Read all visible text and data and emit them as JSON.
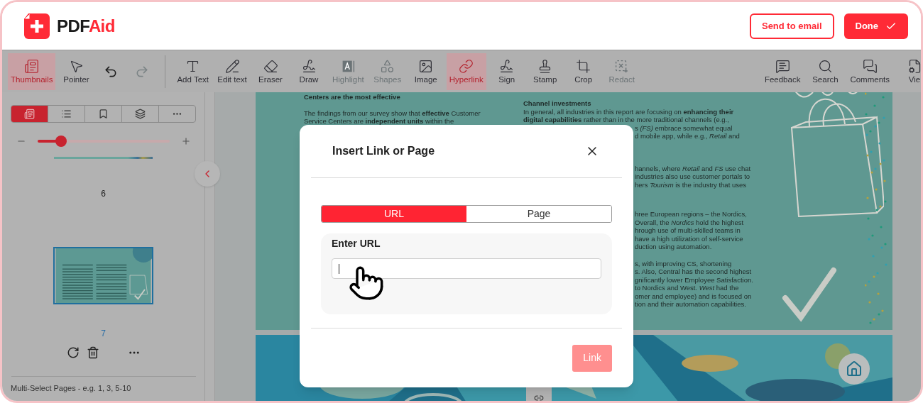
{
  "header": {
    "logo": {
      "text_dark": "PDF",
      "text_accent": "Aid"
    },
    "buttons": [
      {
        "label": "Send to email",
        "kind": "outline"
      },
      {
        "label": "Done",
        "kind": "primary"
      }
    ]
  },
  "toolbar": {
    "left": [
      {
        "kind": "tool",
        "label": "Thumbnails",
        "selected": true,
        "disabled": false
      },
      {
        "kind": "tool",
        "label": "Pointer",
        "selected": false,
        "disabled": false
      },
      {
        "kind": "undo",
        "disabled": false
      },
      {
        "kind": "redo",
        "disabled": true
      },
      {
        "kind": "divider"
      },
      {
        "kind": "tool",
        "label": "Add Text",
        "selected": false,
        "disabled": false
      },
      {
        "kind": "tool",
        "label": "Edit text",
        "selected": false,
        "disabled": false
      },
      {
        "kind": "tool",
        "label": "Eraser",
        "selected": false,
        "disabled": false
      },
      {
        "kind": "tool",
        "label": "Draw",
        "selected": false,
        "disabled": false
      },
      {
        "kind": "tool",
        "label": "Highlight",
        "selected": false,
        "disabled": true
      },
      {
        "kind": "tool",
        "label": "Shapes",
        "selected": false,
        "disabled": true
      },
      {
        "kind": "tool",
        "label": "Image",
        "selected": false,
        "disabled": false
      },
      {
        "kind": "tool",
        "label": "Hyperlink",
        "selected": true,
        "disabled": false
      },
      {
        "kind": "tool",
        "label": "Sign",
        "selected": false,
        "disabled": false
      },
      {
        "kind": "tool",
        "label": "Stamp",
        "selected": false,
        "disabled": false
      },
      {
        "kind": "tool",
        "label": "Crop",
        "selected": false,
        "disabled": false
      },
      {
        "kind": "tool",
        "label": "Redact",
        "selected": false,
        "disabled": true
      }
    ],
    "right": [
      {
        "label": "Feedback"
      },
      {
        "label": "Search"
      },
      {
        "label": "Comments"
      },
      {
        "label": "Vie"
      }
    ]
  },
  "sidebar": {
    "tabs": [
      {
        "selected": true
      },
      {
        "selected": false
      },
      {
        "selected": false
      },
      {
        "selected": false
      },
      {
        "selected": false
      }
    ],
    "zoom_slider": {
      "level": 0.18
    },
    "pages": [
      {
        "number": "6",
        "selected": false,
        "kind": "cut"
      },
      {
        "number": "7",
        "selected": true,
        "kind": "full"
      }
    ],
    "multi_select": "Multi-Select Pages - e.g. 1, 3, 5-10"
  },
  "document": {
    "left_lines": [
      "Centers are the most effective",
      "The findings from our survey show that **effective** Customer",
      "Service Centers are **independent units** within the"
    ],
    "right_blocks": [
      {
        "kind": "full",
        "lines": [
          "**Channel investments**",
          "In general, all industries in this report are focusing on **enhancing their**",
          "**digital capabilities** rather than in the more traditional channels (e.g.,"
        ]
      },
      {
        "kind": "partial",
        "lines": [
          "s *(FS)* embrace somewhat equal",
          "d mobile app, while e.g., *Retail* and"
        ]
      },
      {
        "kind": "partial",
        "lines": [
          "hannels, where *Retail* and *FS* use chat",
          "industries also use customer portals to",
          "hers *Tourism* is the industry that uses"
        ]
      },
      {
        "kind": "partial",
        "lines": [
          "hree European regions – the Nordics,",
          "Overall, the *Nordics* hold the highest",
          "hrough use of multi-skilled teams in",
          "have a high utilization of self-service",
          "duction using automation."
        ]
      },
      {
        "kind": "partial",
        "lines": [
          "s, with improving CS, shortening",
          "s. Also, Central has the second highest",
          "gnificantly lower Employee Satisfaction.",
          "to Nordics and West. *West* had the",
          "omer and employee) and is focused on",
          "tion and their automation capabilities."
        ]
      }
    ]
  },
  "dialog": {
    "title": "Insert Link or Page",
    "tabs": [
      {
        "label": "URL",
        "selected": true
      },
      {
        "label": "Page",
        "selected": false
      }
    ],
    "field_label": "Enter URL",
    "link_button": {
      "label": "Link",
      "disabled": true
    }
  }
}
